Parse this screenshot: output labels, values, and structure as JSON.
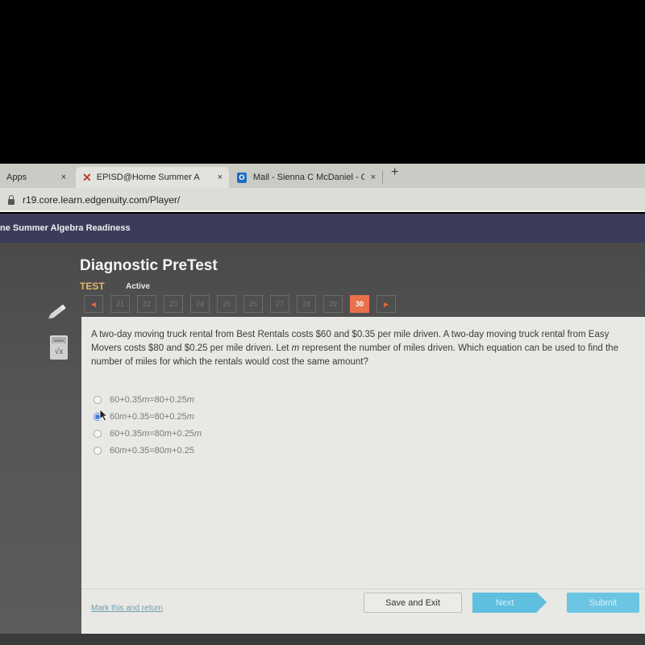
{
  "browser": {
    "tabs": [
      {
        "label": "Apps",
        "icon": "apps-icon",
        "active": false
      },
      {
        "label": "EPISD@Home Summer Algebra",
        "icon": "edgenuity-x-icon",
        "active": true
      },
      {
        "label": "Mail - Sienna C McDaniel - Out",
        "icon": "outlook-icon",
        "active": false
      }
    ],
    "new_tab_label": "+",
    "close_glyph": "×",
    "address": "r19.core.learn.edgenuity.com/Player/"
  },
  "app": {
    "course_title": "ne Summer Algebra Readiness"
  },
  "test": {
    "title": "Diagnostic PreTest",
    "type_label": "TEST",
    "status": "Active",
    "pager": {
      "prev_glyph": "◀",
      "next_glyph": "▶",
      "pages": [
        "21",
        "22",
        "23",
        "24",
        "25",
        "26",
        "27",
        "28",
        "29",
        "30"
      ],
      "current_page": "30"
    }
  },
  "tools": [
    {
      "name": "pencil-icon",
      "label": "Pencil"
    },
    {
      "name": "calculator-icon",
      "label": "Calculator"
    },
    {
      "name": "formula-icon",
      "label": "√x"
    }
  ],
  "question": {
    "text": "A two-day moving truck rental from Best Rentals costs $60 and $0.35 per mile driven. A two-day moving truck rental from Easy Movers costs $80 and $0.25 per mile driven. Let m represent the number of miles driven. Which equation can be used to find the number of miles for which the rentals would cost the same amount?",
    "options": [
      {
        "label": "60+0.35m=80+0.25m",
        "selected": false
      },
      {
        "label": "60m+0.35=80+0.25m",
        "selected": true
      },
      {
        "label": "60+0.35m=80m+0.25m",
        "selected": false
      },
      {
        "label": "60m+0.35=80m+0.25",
        "selected": false
      }
    ]
  },
  "footer": {
    "mark_link": "Mark this and return",
    "save_exit": "Save and Exit",
    "next": "Next",
    "submit": "Submit"
  },
  "colors": {
    "accent_orange": "#e8704a",
    "test_label": "#e8b868",
    "button_blue": "#5ebfdf",
    "radio_selected": "#3f7de0",
    "app_header": "#3b3c5a"
  }
}
